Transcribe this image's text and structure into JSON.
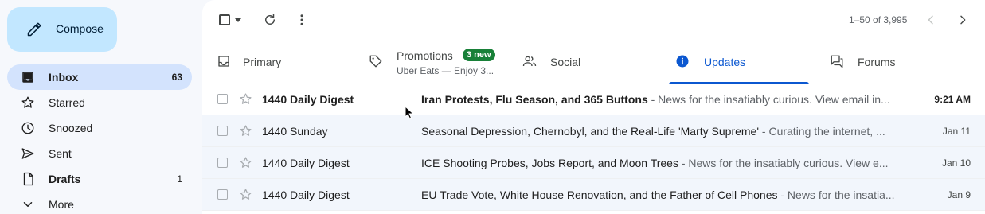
{
  "compose": {
    "label": "Compose",
    "icon": "pencil-icon"
  },
  "nav": [
    {
      "label": "Inbox",
      "count": "63",
      "icon": "inbox-icon",
      "active": true
    },
    {
      "label": "Starred",
      "count": "",
      "icon": "star-icon"
    },
    {
      "label": "Snoozed",
      "count": "",
      "icon": "clock-icon"
    },
    {
      "label": "Sent",
      "count": "",
      "icon": "send-icon"
    },
    {
      "label": "Drafts",
      "count": "1",
      "icon": "draft-icon"
    },
    {
      "label": "More",
      "count": "",
      "icon": "chevron-down-icon"
    }
  ],
  "toolbar": {
    "pager": "1–50 of 3,995"
  },
  "tabs": [
    {
      "label": "Primary",
      "icon": "inbox-tab-icon"
    },
    {
      "label": "Promotions",
      "icon": "tag-icon",
      "badge": "3 new",
      "subtitle": "Uber Eats — Enjoy 3..."
    },
    {
      "label": "Social",
      "icon": "people-icon"
    },
    {
      "label": "Updates",
      "icon": "info-icon",
      "active": true
    },
    {
      "label": "Forums",
      "icon": "forum-icon"
    }
  ],
  "emails": [
    {
      "sender": "1440 Daily Digest",
      "subject": "Iran Protests, Flu Season, and 365 Buttons",
      "snippet": " - News for the insatiably curious. View email in...",
      "date": "9:21 AM",
      "unread": true
    },
    {
      "sender": "1440 Sunday",
      "subject": "Seasonal Depression, Chernobyl, and the Real-Life 'Marty Supreme'",
      "snippet": " - Curating the internet, ...",
      "date": "Jan 11",
      "unread": false
    },
    {
      "sender": "1440 Daily Digest",
      "subject": "ICE Shooting Probes, Jobs Report, and Moon Trees",
      "snippet": " - News for the insatiably curious. View e...",
      "date": "Jan 10",
      "unread": false
    },
    {
      "sender": "1440 Daily Digest",
      "subject": "EU Trade Vote, White House Renovation, and the Father of Cell Phones",
      "snippet": " - News for the insatia...",
      "date": "Jan 9",
      "unread": false
    }
  ],
  "colors": {
    "accent": "#0b57d0",
    "compose_bg": "#c2e7ff",
    "active_nav_bg": "#d3e3fd",
    "badge_bg": "#188038"
  }
}
